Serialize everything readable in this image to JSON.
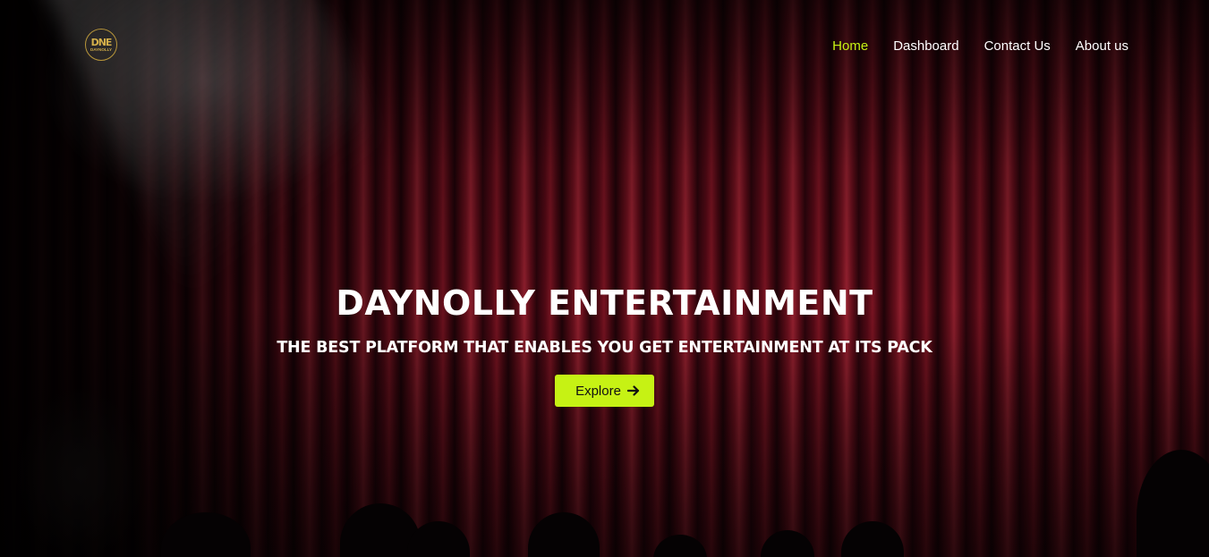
{
  "brand": {
    "logo_mark": "DNE",
    "logo_text": "DAYNOLLY",
    "icon": "daynolly-logo-icon",
    "colors": {
      "accent": "#c6f214",
      "gold": "#d4af4a",
      "curtain": "#a01a2c"
    }
  },
  "nav": {
    "items": [
      {
        "label": "Home",
        "active": true
      },
      {
        "label": "Dashboard",
        "active": false
      },
      {
        "label": "Contact Us",
        "active": false
      },
      {
        "label": "About us",
        "active": false
      }
    ]
  },
  "hero": {
    "title": "DAYNOLLY ENTERTAINMENT",
    "subtitle": "THE BEST PLATFORM THAT ENABLES YOU GET ENTERTAINMENT AT ITS PACK",
    "cta_label": "Explore",
    "cta_icon": "arrow-right-icon"
  }
}
